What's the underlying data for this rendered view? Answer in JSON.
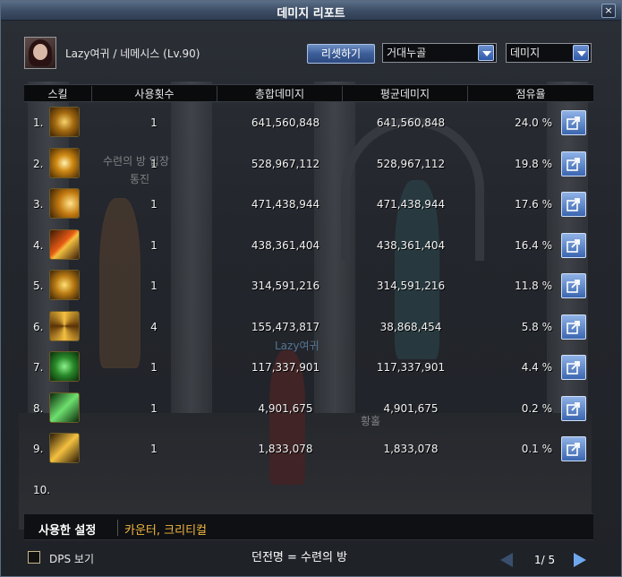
{
  "window": {
    "title": "데미지 리포트",
    "close_glyph": "×"
  },
  "character": {
    "name": "Lazy여귀 / 네메시스 (Lv.90)"
  },
  "toolbar": {
    "reset_label": "리셋하기",
    "target_select": "거대누골",
    "metric_select": "데미지"
  },
  "table": {
    "columns": [
      "스킬",
      "사용횟수",
      "총합데미지",
      "평균데미지",
      "점유율"
    ],
    "rows": [
      {
        "rank": "1.",
        "icon": "skill-icon-1",
        "count": "1",
        "total": "641,560,848",
        "avg": "641,560,848",
        "share": "24.0 %"
      },
      {
        "rank": "2.",
        "icon": "skill-icon-2",
        "count": "1",
        "total": "528,967,112",
        "avg": "528,967,112",
        "share": "19.8 %"
      },
      {
        "rank": "3.",
        "icon": "skill-icon-3",
        "count": "1",
        "total": "471,438,944",
        "avg": "471,438,944",
        "share": "17.6 %"
      },
      {
        "rank": "4.",
        "icon": "skill-icon-4",
        "count": "1",
        "total": "438,361,404",
        "avg": "438,361,404",
        "share": "16.4 %"
      },
      {
        "rank": "5.",
        "icon": "skill-icon-5",
        "count": "1",
        "total": "314,591,216",
        "avg": "314,591,216",
        "share": "11.8 %"
      },
      {
        "rank": "6.",
        "icon": "skill-icon-6",
        "count": "4",
        "total": "155,473,817",
        "avg": "38,868,454",
        "share": "5.8 %"
      },
      {
        "rank": "7.",
        "icon": "skill-icon-7",
        "count": "1",
        "total": "117,337,901",
        "avg": "117,337,901",
        "share": "4.4 %"
      },
      {
        "rank": "8.",
        "icon": "skill-icon-8",
        "count": "1",
        "total": "4,901,675",
        "avg": "4,901,675",
        "share": "0.2 %"
      },
      {
        "rank": "9.",
        "icon": "skill-icon-9",
        "count": "1",
        "total": "1,833,078",
        "avg": "1,833,078",
        "share": "0.1 %"
      },
      {
        "rank": "10."
      }
    ]
  },
  "settings": {
    "label": "사용한 설정",
    "value": "카운터, 크리티컬"
  },
  "footer": {
    "dps_label": "DPS 보기",
    "dungeon": "던전명 = 수련의 방",
    "page": "1/ 5"
  },
  "scene": {
    "text1": "수련의 방 입장",
    "text2": "통진",
    "text3": "Lazy여귀",
    "text4": "황홀"
  },
  "colors": {
    "accent": "#3d5e98",
    "setting_value": "#f2b840",
    "title_bar": "#3d4e66"
  }
}
